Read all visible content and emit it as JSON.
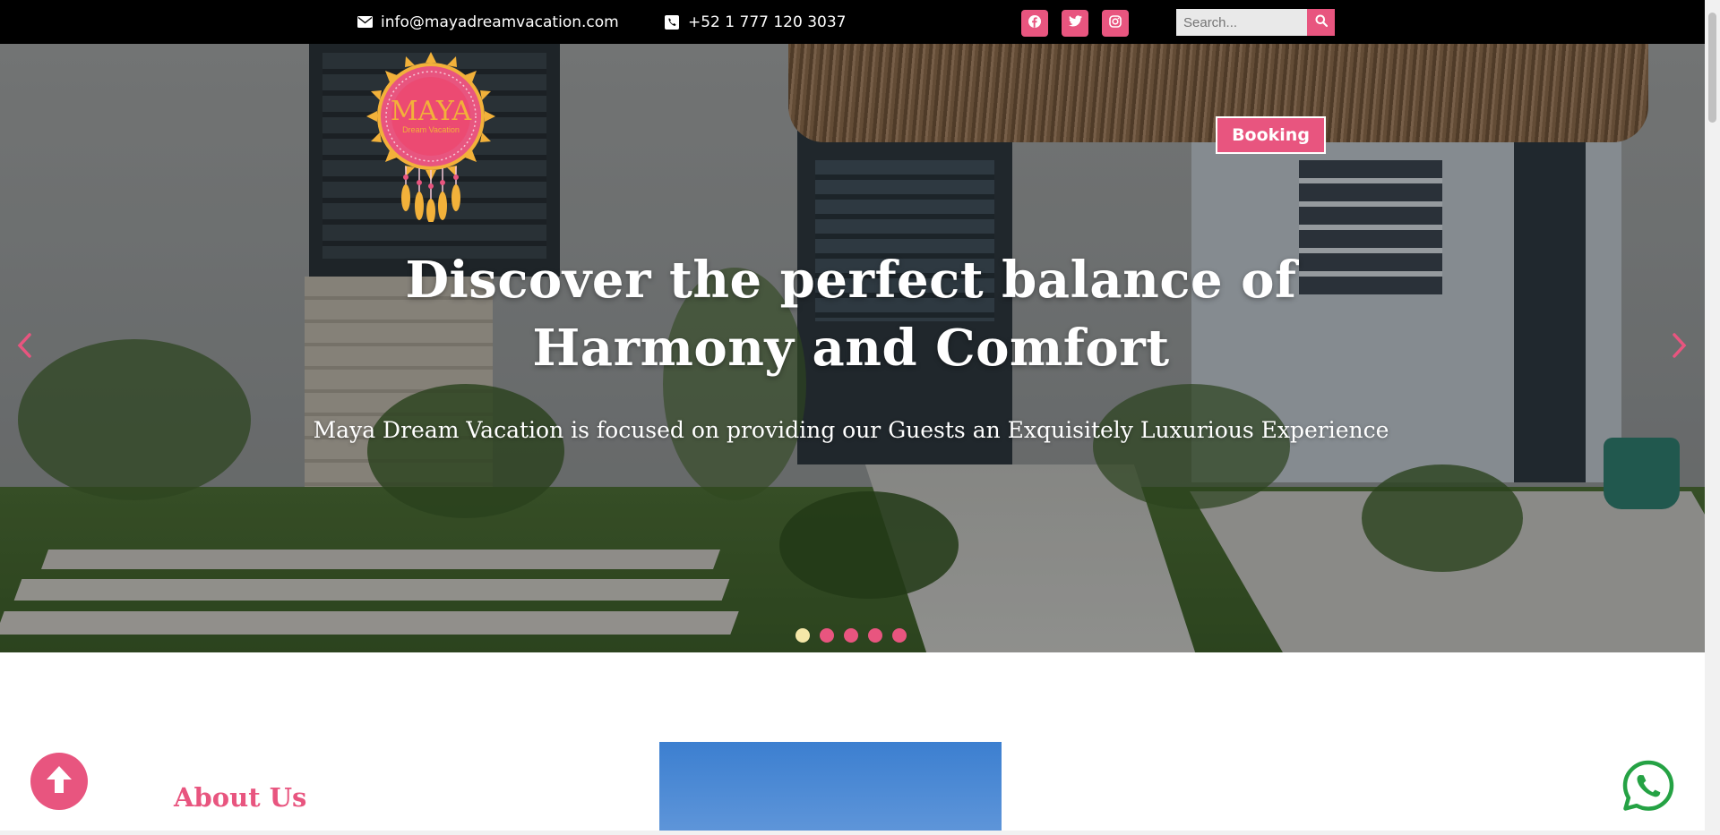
{
  "topbar": {
    "email": "info@mayadreamvacation.com",
    "phone": "+52 1 777 120 3037",
    "social": [
      "facebook-icon",
      "twitter-icon",
      "instagram-icon"
    ],
    "search_placeholder": "Search..."
  },
  "header": {
    "logo_text": "MAYA",
    "logo_subtext": "Dream Vacation",
    "booking_label": "Booking"
  },
  "hero": {
    "title_line1": "Discover the perfect balance of",
    "title_line2": "Harmony and Comfort",
    "subtitle": "Maya Dream Vacation is focused on providing our Guests an Exquisitely Luxurious Experience",
    "slides_count": 5,
    "active_slide": 1
  },
  "about": {
    "title": "About Us"
  },
  "colors": {
    "accent": "#e8557f",
    "topbar_bg": "#000000",
    "dot_active": "#f5e7a8",
    "whatsapp": "#25a244"
  }
}
